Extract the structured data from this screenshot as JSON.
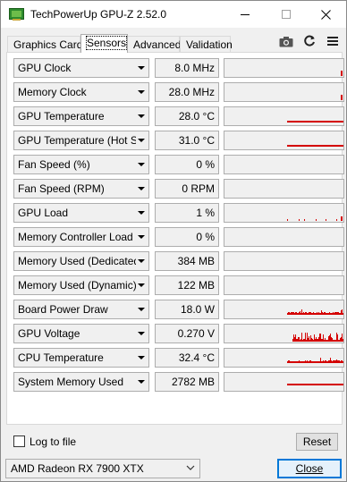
{
  "window": {
    "title": "TechPowerUp GPU-Z 2.52.0"
  },
  "tabs": [
    {
      "label": "Graphics Card",
      "active": false
    },
    {
      "label": "Sensors",
      "active": true
    },
    {
      "label": "Advanced",
      "active": false
    },
    {
      "label": "Validation",
      "active": false
    }
  ],
  "toolbar": {
    "icons": [
      "camera-icon",
      "refresh-icon",
      "menu-icon"
    ]
  },
  "colors": {
    "graph_line": "#d40000"
  },
  "sensors": [
    {
      "name": "GPU Clock",
      "value": "8.0 MHz",
      "graph": "tick"
    },
    {
      "name": "Memory Clock",
      "value": "28.0 MHz",
      "graph": "tick"
    },
    {
      "name": "GPU Temperature",
      "value": "28.0 °C",
      "graph": "flat"
    },
    {
      "name": "GPU Temperature (Hot Spot)",
      "value": "31.0 °C",
      "graph": "flat"
    },
    {
      "name": "Fan Speed (%)",
      "value": "0 %",
      "graph": "none"
    },
    {
      "name": "Fan Speed (RPM)",
      "value": "0 RPM",
      "graph": "none"
    },
    {
      "name": "GPU Load",
      "value": "1 %",
      "graph": "dots"
    },
    {
      "name": "Memory Controller Load",
      "value": "0 %",
      "graph": "none"
    },
    {
      "name": "Memory Used (Dedicated)",
      "value": "384 MB",
      "graph": "none"
    },
    {
      "name": "Memory Used (Dynamic)",
      "value": "122 MB",
      "graph": "none"
    },
    {
      "name": "Board Power Draw",
      "value": "18.0 W",
      "graph": "noisy-low"
    },
    {
      "name": "GPU Voltage",
      "value": "0.270 V",
      "graph": "noisy-mid"
    },
    {
      "name": "CPU Temperature",
      "value": "32.4 °C",
      "graph": "noisy-low"
    },
    {
      "name": "System Memory Used",
      "value": "2782 MB",
      "graph": "flat-high"
    }
  ],
  "footer": {
    "log_label": "Log to file",
    "log_checked": false,
    "reset_label": "Reset",
    "gpu_selected": "AMD Radeon RX 7900 XTX",
    "close_label": "Close"
  }
}
